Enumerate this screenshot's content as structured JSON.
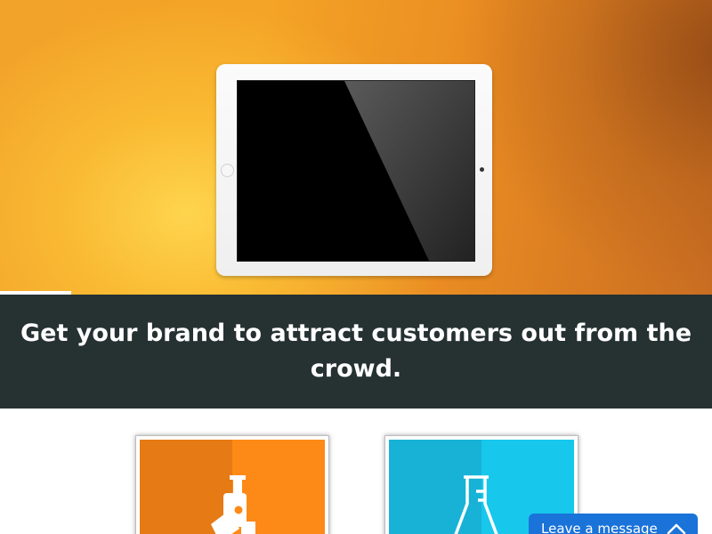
{
  "hero": {
    "slide_progress": 0.1
  },
  "banner": {
    "heading": "Get your brand to attract customers out from the crowd."
  },
  "services": [
    {
      "icon": "microscope-icon",
      "color": "#fd8a17"
    },
    {
      "icon": "flask-icon",
      "color": "#17c7ec"
    }
  ],
  "chat": {
    "label": "Leave a message",
    "icon": "chevron-up-icon",
    "color": "#1a73d9"
  }
}
